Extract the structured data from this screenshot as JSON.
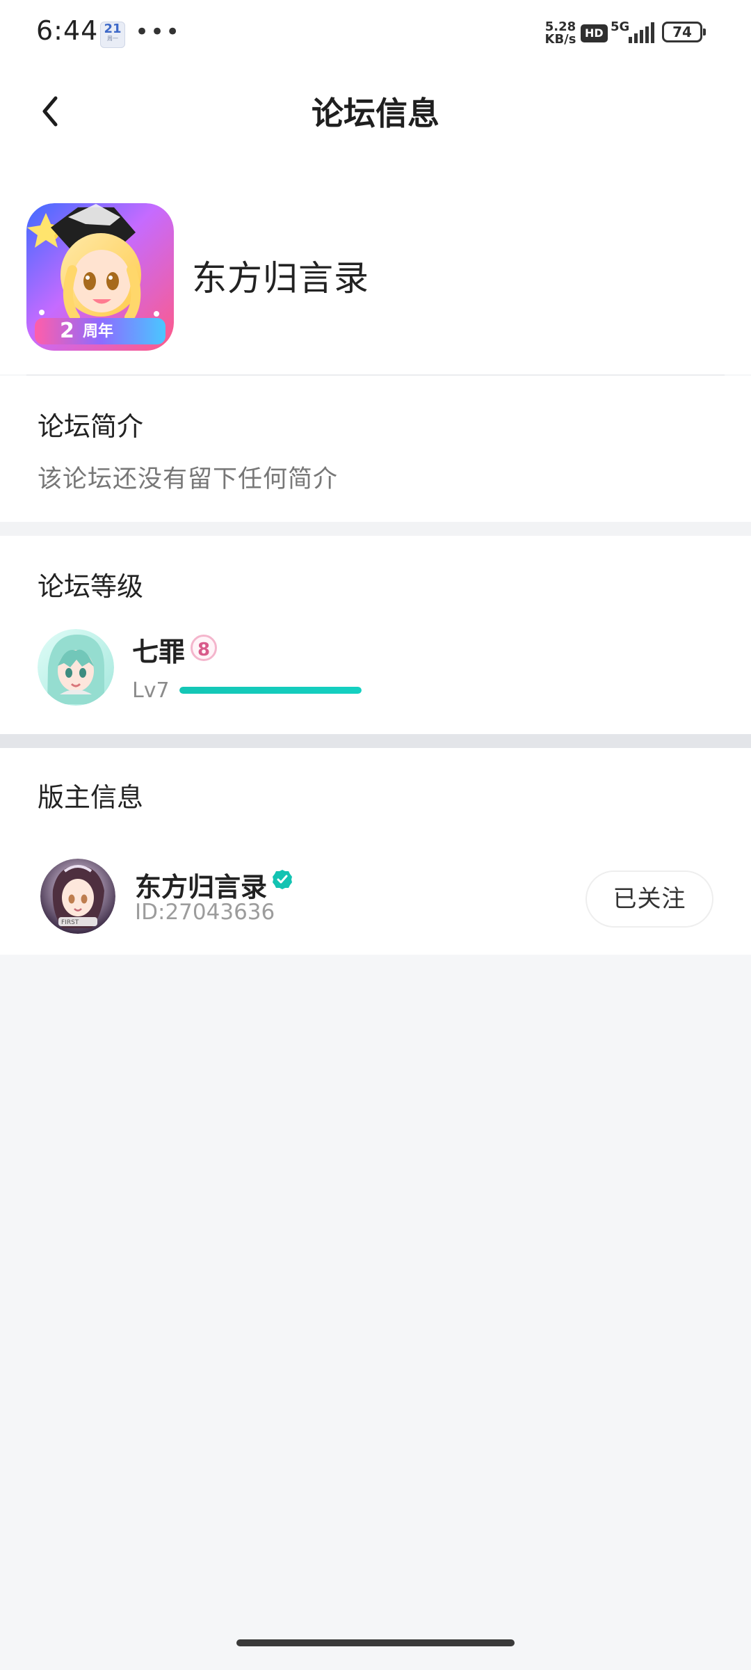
{
  "status_bar": {
    "time": "6:44",
    "calendar_day": "21",
    "calendar_subtext": "周一",
    "dots": "•••",
    "network_speed_value": "5.28",
    "network_speed_unit": "KB/s",
    "hd_label": "HD",
    "network_type": "5G",
    "battery_level": "74"
  },
  "header": {
    "title": "论坛信息"
  },
  "forum": {
    "name": "东方归言录",
    "avatar_badge_text": "2周年"
  },
  "intro": {
    "title": "论坛简介",
    "text": "该论坛还没有留下任何简介"
  },
  "level": {
    "title": "论坛等级",
    "user_name": "七罪",
    "badge_value": "8",
    "level_label": "Lv7",
    "progress": 1.0
  },
  "moderator": {
    "title": "版主信息",
    "name": "东方归言录",
    "id_text": "ID:27043636",
    "follow_label": "已关注"
  },
  "colors": {
    "accent": "#14c6b5",
    "background": "#f5f6f8",
    "divider": "#ebecef"
  },
  "icons": {
    "back": "back-arrow-icon",
    "verified": "verified-icon",
    "signal": "signal-icon",
    "battery": "battery-icon"
  }
}
